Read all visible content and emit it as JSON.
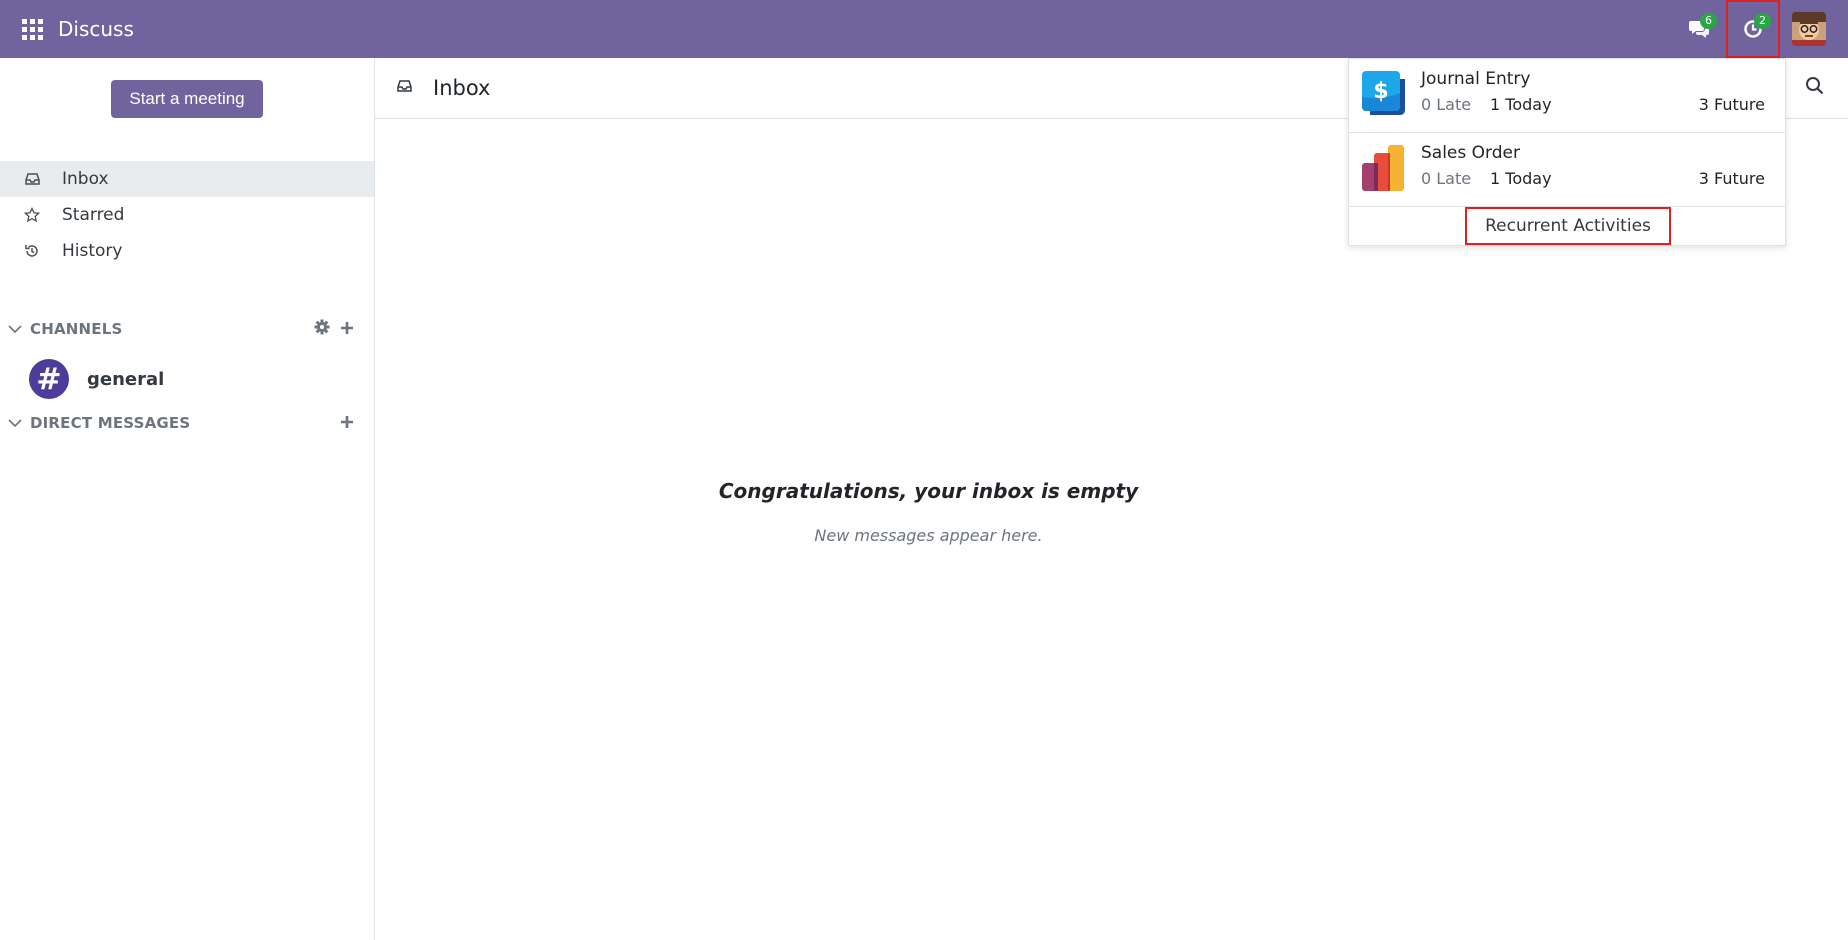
{
  "topbar": {
    "app_title": "Discuss",
    "chat_badge": "6",
    "activity_badge": "2",
    "brand_color": "#71639e"
  },
  "sidebar": {
    "meeting_button": "Start a meeting",
    "nav": [
      {
        "label": "Inbox",
        "icon": "inbox-icon"
      },
      {
        "label": "Starred",
        "icon": "star-icon"
      },
      {
        "label": "History",
        "icon": "history-icon"
      }
    ],
    "channels_header": "CHANNELS",
    "channels": [
      {
        "name": "general",
        "avatar_glyph": "#"
      }
    ],
    "dm_header": "DIRECT MESSAGES"
  },
  "main": {
    "title": "Inbox",
    "empty_title": "Congratulations, your inbox is empty",
    "empty_subtitle": "New messages appear here."
  },
  "activity_dropdown": {
    "items": [
      {
        "name": "Journal Entry",
        "late": "0 Late",
        "today": "1 Today",
        "future": "3 Future",
        "icon": "accounting-icon"
      },
      {
        "name": "Sales Order",
        "late": "0 Late",
        "today": "1 Today",
        "future": "3 Future",
        "icon": "sales-icon"
      }
    ],
    "recurrent_link": "Recurrent Activities"
  }
}
